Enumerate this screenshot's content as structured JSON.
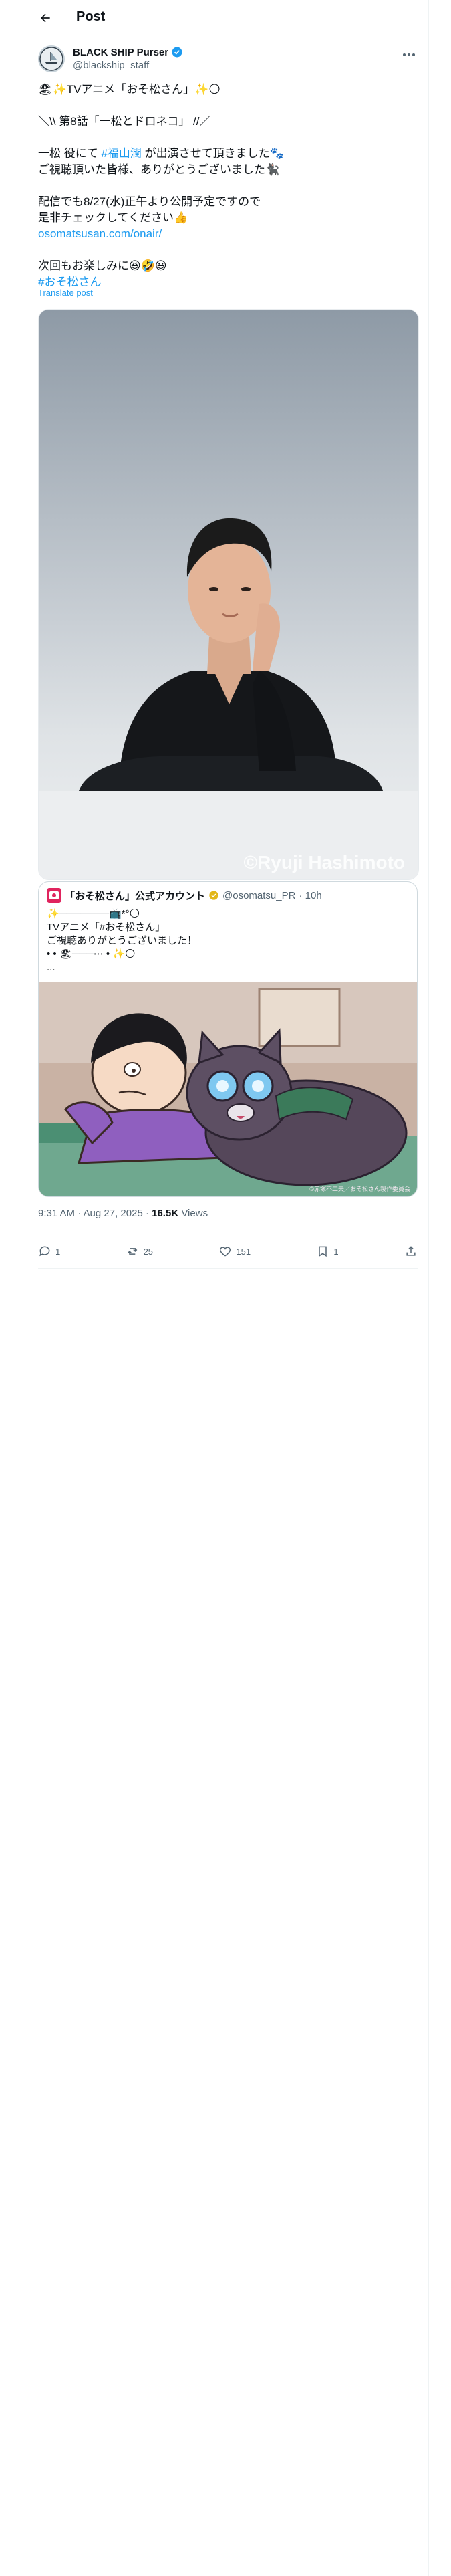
{
  "header": {
    "title": "Post"
  },
  "author": {
    "display_name": "BLACK SHIP Purser",
    "handle": "@blackship_staff",
    "verified": true
  },
  "post": {
    "lines": [
      "🏖✨TVアニメ「おそ松さん」✨🌕",
      "",
      "＼\\\\  第8話「一松とドロネコ」  //／",
      "",
      "一松 役にて #福山潤 が出演させて頂きました🐾",
      "ご視聴頂いた皆様、ありがとうございました🐈‍⬛",
      "",
      "配信でも8/27(水)正午より公開予定ですので",
      "是非チェックしてください👍",
      "osomatsusan.com/onair/",
      "#おそ松さん",
      "",
      "次回もお楽しみに😆🤣😃"
    ],
    "line1": "🏖✨TVアニメ「おそ松さん」✨🌕",
    "line2": "＼\\\\  第8話「一松とドロネコ」  //／",
    "line3_pre": "一松 役にて ",
    "line3_tag": "#福山潤",
    "line3_post": " が出演させて頂きました🐾",
    "line4": "ご視聴頂いた皆様、ありがとうございました🐈‍⬛",
    "line5": "配信でも8/27(水)正午より公開予定ですので",
    "line6": "是非チェックしてください👍",
    "link": "osomatsusan.com/onair/",
    "line8": "次回もお楽しみに😆🤣😃",
    "hashtag": "#おそ松さん",
    "translate_label": "Translate post",
    "photo_credit": "©Ryuji Hashimoto"
  },
  "quote": {
    "display_name": "「おそ松さん」公式アカウント",
    "handle": "@osomatsu_PR",
    "time": "· 10h",
    "verified": true,
    "line1": "✨───────📺*°🌕",
    "line2": "TVアニメ「#おそ松さん」",
    "line3": "ご視聴ありがとうございました！",
    "line4": "• • 🏖───⋯ • ✨🌕",
    "line5": "...",
    "image_caption": "©赤塚不二夫／おそ松さん製作委員会"
  },
  "meta": {
    "time": "9:31 AM · Aug 27, 2025 · ",
    "views_count": "16.5K",
    "views_label": " Views"
  },
  "actions": {
    "replies": "1",
    "reposts": "25",
    "likes": "151",
    "bookmarks": "1"
  },
  "colors": {
    "accent": "#1d9bf0",
    "text": "#0f1419",
    "muted": "#536471"
  }
}
